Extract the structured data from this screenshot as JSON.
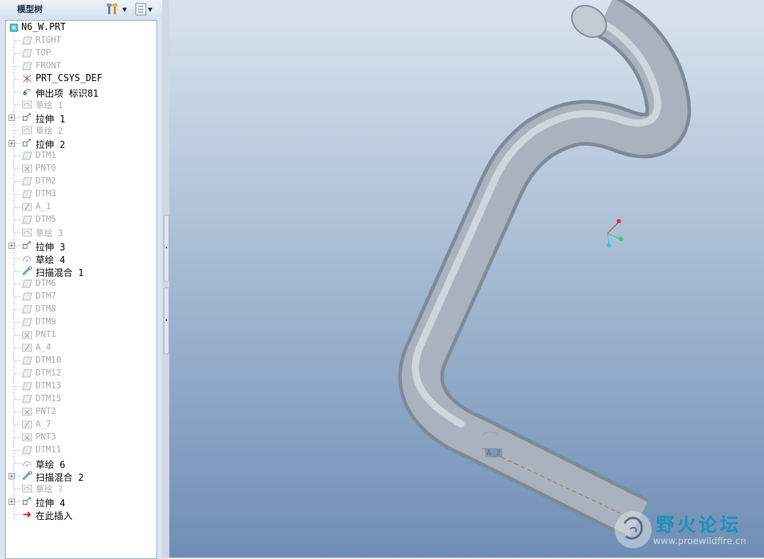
{
  "panel": {
    "title": "模型树"
  },
  "tree": [
    {
      "label": "N6_W.PRT",
      "dim": false,
      "icon": "part-icon",
      "expand": false
    },
    {
      "label": "RIGHT",
      "dim": true,
      "icon": "datum-plane-icon",
      "expand": false
    },
    {
      "label": "TOP",
      "dim": true,
      "icon": "datum-plane-icon",
      "expand": false
    },
    {
      "label": "FRONT",
      "dim": true,
      "icon": "datum-plane-icon",
      "expand": false
    },
    {
      "label": "PRT_CSYS_DEF",
      "dim": false,
      "icon": "csys-icon",
      "expand": false
    },
    {
      "label": "伸出项 标识81",
      "dim": false,
      "icon": "protrusion-icon",
      "expand": false
    },
    {
      "label": "草绘 1",
      "dim": true,
      "icon": "sketch-icon",
      "expand": false
    },
    {
      "label": "拉伸 1",
      "dim": false,
      "icon": "extrude-icon",
      "expand": true
    },
    {
      "label": "草绘 2",
      "dim": true,
      "icon": "sketch-icon",
      "expand": false
    },
    {
      "label": "拉伸 2",
      "dim": false,
      "icon": "extrude-icon",
      "expand": true
    },
    {
      "label": "DTM1",
      "dim": true,
      "icon": "datum-plane-icon",
      "expand": false
    },
    {
      "label": "PNT0",
      "dim": true,
      "icon": "datum-point-icon",
      "expand": false
    },
    {
      "label": "DTM2",
      "dim": true,
      "icon": "datum-plane-icon",
      "expand": false
    },
    {
      "label": "DTM3",
      "dim": true,
      "icon": "datum-plane-icon",
      "expand": false
    },
    {
      "label": "A_1",
      "dim": true,
      "icon": "datum-axis-icon",
      "expand": false
    },
    {
      "label": "DTM5",
      "dim": true,
      "icon": "datum-plane-icon",
      "expand": false
    },
    {
      "label": "草绘 3",
      "dim": true,
      "icon": "sketch-icon",
      "expand": false
    },
    {
      "label": "拉伸 3",
      "dim": false,
      "icon": "extrude-icon",
      "expand": true
    },
    {
      "label": "草绘 4",
      "dim": false,
      "icon": "sketch-active-icon",
      "expand": false
    },
    {
      "label": "扫描混合 1",
      "dim": false,
      "icon": "swept-blend-icon",
      "expand": false
    },
    {
      "label": "DTM6",
      "dim": true,
      "icon": "datum-plane-icon",
      "expand": false
    },
    {
      "label": "DTM7",
      "dim": true,
      "icon": "datum-plane-icon",
      "expand": false
    },
    {
      "label": "DTM8",
      "dim": true,
      "icon": "datum-plane-icon",
      "expand": false
    },
    {
      "label": "DTM9",
      "dim": true,
      "icon": "datum-plane-icon",
      "expand": false
    },
    {
      "label": "PNT1",
      "dim": true,
      "icon": "datum-point-icon",
      "expand": false
    },
    {
      "label": "A_4",
      "dim": true,
      "icon": "datum-axis-icon",
      "expand": false
    },
    {
      "label": "DTM10",
      "dim": true,
      "icon": "datum-plane-icon",
      "expand": false
    },
    {
      "label": "DTM12",
      "dim": true,
      "icon": "datum-plane-icon",
      "expand": false
    },
    {
      "label": "DTM13",
      "dim": true,
      "icon": "datum-plane-icon",
      "expand": false
    },
    {
      "label": "DTM15",
      "dim": true,
      "icon": "datum-plane-icon",
      "expand": false
    },
    {
      "label": "PNT2",
      "dim": true,
      "icon": "datum-point-icon",
      "expand": false
    },
    {
      "label": "A_7",
      "dim": true,
      "icon": "datum-axis-icon",
      "expand": false
    },
    {
      "label": "PNT3",
      "dim": true,
      "icon": "datum-point-icon",
      "expand": false
    },
    {
      "label": "DTM11",
      "dim": true,
      "icon": "datum-plane-icon",
      "expand": false
    },
    {
      "label": "草绘 6",
      "dim": false,
      "icon": "sketch-active-icon",
      "expand": false
    },
    {
      "label": "扫描混合 2",
      "dim": false,
      "icon": "swept-blend-icon",
      "expand": true
    },
    {
      "label": "草绘 7",
      "dim": true,
      "icon": "sketch-icon",
      "expand": false
    },
    {
      "label": "拉伸 4",
      "dim": false,
      "icon": "extrude-icon",
      "expand": true
    },
    {
      "label": "在此插入",
      "dim": false,
      "icon": "insert-here-icon",
      "expand": false
    }
  ],
  "viewport": {
    "axis_label": "A_2",
    "logo_text": "野火论坛",
    "logo_url": "www.proewildfire.cn"
  },
  "colors": {
    "pipe": "#a9b3bf",
    "background_top": "#d9e3ee",
    "background_bottom": "#6f8eb5",
    "csys_x": "#e0303a",
    "csys_y": "#33cc55",
    "csys_z": "#33c8e0"
  }
}
